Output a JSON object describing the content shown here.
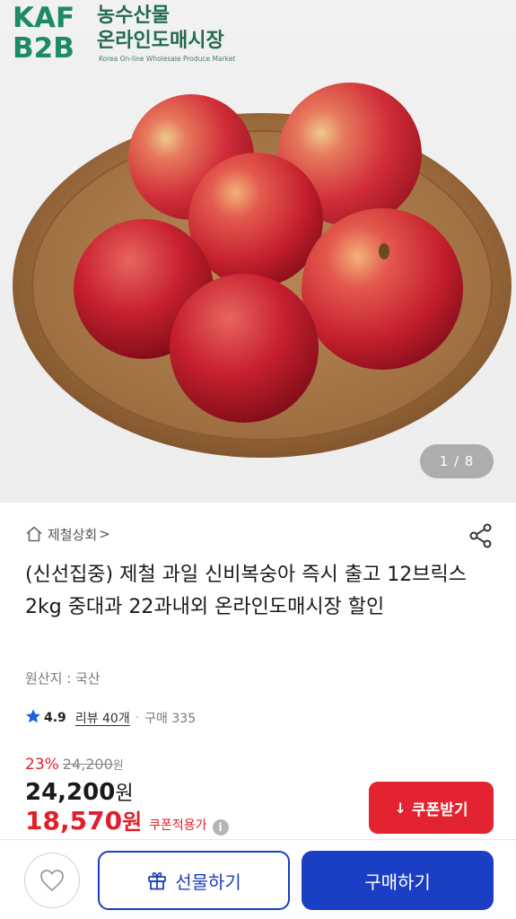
{
  "logo": {
    "brand_line1": "KAF",
    "brand_line2": "B2B",
    "korean_line1": "농수산물",
    "korean_line2": "온라인도매시장",
    "english": "Korea On-line Wholesale Produce Market"
  },
  "gallery": {
    "counter": "1 / 8",
    "current": 1,
    "total": 8
  },
  "store": {
    "name": "제철상회",
    "chevron": ">",
    "icon": "home-icon"
  },
  "product": {
    "title": "(신선집중) 제철 과일 신비복숭아 즉시 출고 12브릭스 2kg 중대과 22과내외 온라인도매시장 할인",
    "origin": "원산지 : 국산"
  },
  "rating": {
    "score": "4.9",
    "review_label": "리뷰 40개",
    "separator": "·",
    "sales_label": "구매 335"
  },
  "pricing": {
    "discount_rate": "23%",
    "original_price": "24,200",
    "original_won": "원",
    "price": "24,200",
    "price_won": "원",
    "coupon_price": "18,570",
    "coupon_won": "원",
    "coupon_applied_label": "쿠폰적용가",
    "info_icon": "i"
  },
  "coupon_button": {
    "icon": "↓",
    "label": "쿠폰받기"
  },
  "bottom_bar": {
    "gift_label": "선물하기",
    "buy_label": "구매하기"
  },
  "colors": {
    "brand_green": "#1d8a63",
    "accent_red": "#e01f2b",
    "coupon_red": "#e3232f",
    "primary_blue": "#1b3fc4"
  }
}
